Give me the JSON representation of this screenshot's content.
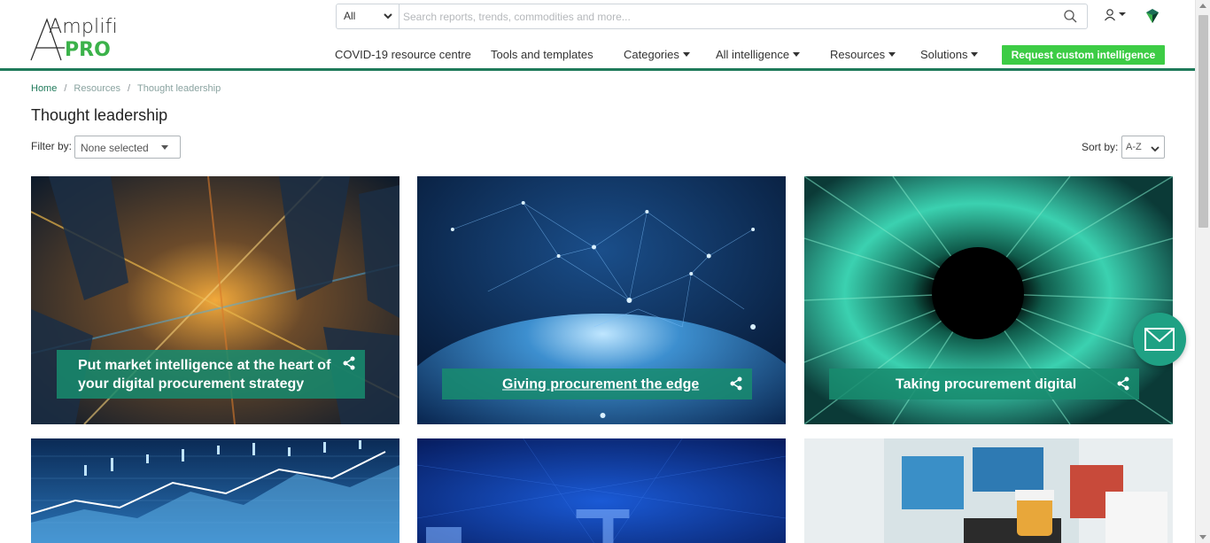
{
  "brand": {
    "logo_text_top": "Amplifi",
    "logo_text_bottom": "PRO",
    "colors": {
      "green": "#1f7a5a",
      "cta": "#3dcc45",
      "teal_overlay": "#178c6e",
      "pro": "#3bb24a"
    }
  },
  "search": {
    "scope_value": "All",
    "placeholder": "Search reports, trends, commodities and more...",
    "button_icon": "search-icon"
  },
  "header_icons": {
    "user": "user-icon",
    "brand": "diamond-icon"
  },
  "nav": {
    "items": [
      {
        "label": "COVID-19 resource centre",
        "dropdown": false
      },
      {
        "label": "Tools and templates",
        "dropdown": false
      },
      {
        "label": "Categories",
        "dropdown": true
      },
      {
        "label": "All intelligence",
        "dropdown": true
      },
      {
        "label": "Resources",
        "dropdown": true
      },
      {
        "label": "Solutions",
        "dropdown": true
      }
    ],
    "cta_label": "Request custom intelligence"
  },
  "breadcrumb": [
    "Home",
    "Resources",
    "Thought leadership"
  ],
  "page_title": "Thought leadership",
  "filter": {
    "label": "Filter by:",
    "value": "None selected"
  },
  "sort": {
    "label": "Sort by:",
    "value": "A-Z"
  },
  "cards": [
    {
      "title_line1": "Put market intelligence at the heart of",
      "title_line2": "your digital procurement strategy",
      "image": "city-night-aerial"
    },
    {
      "title": "Giving procurement the edge",
      "image": "globe-network"
    },
    {
      "title": "Taking procurement digital",
      "image": "green-light-tunnel"
    },
    {
      "image": "financial-chart"
    },
    {
      "image": "digital-blue-circuit"
    },
    {
      "image": "pharmacy-bottles"
    }
  ],
  "fab": {
    "icon": "mail-icon"
  }
}
